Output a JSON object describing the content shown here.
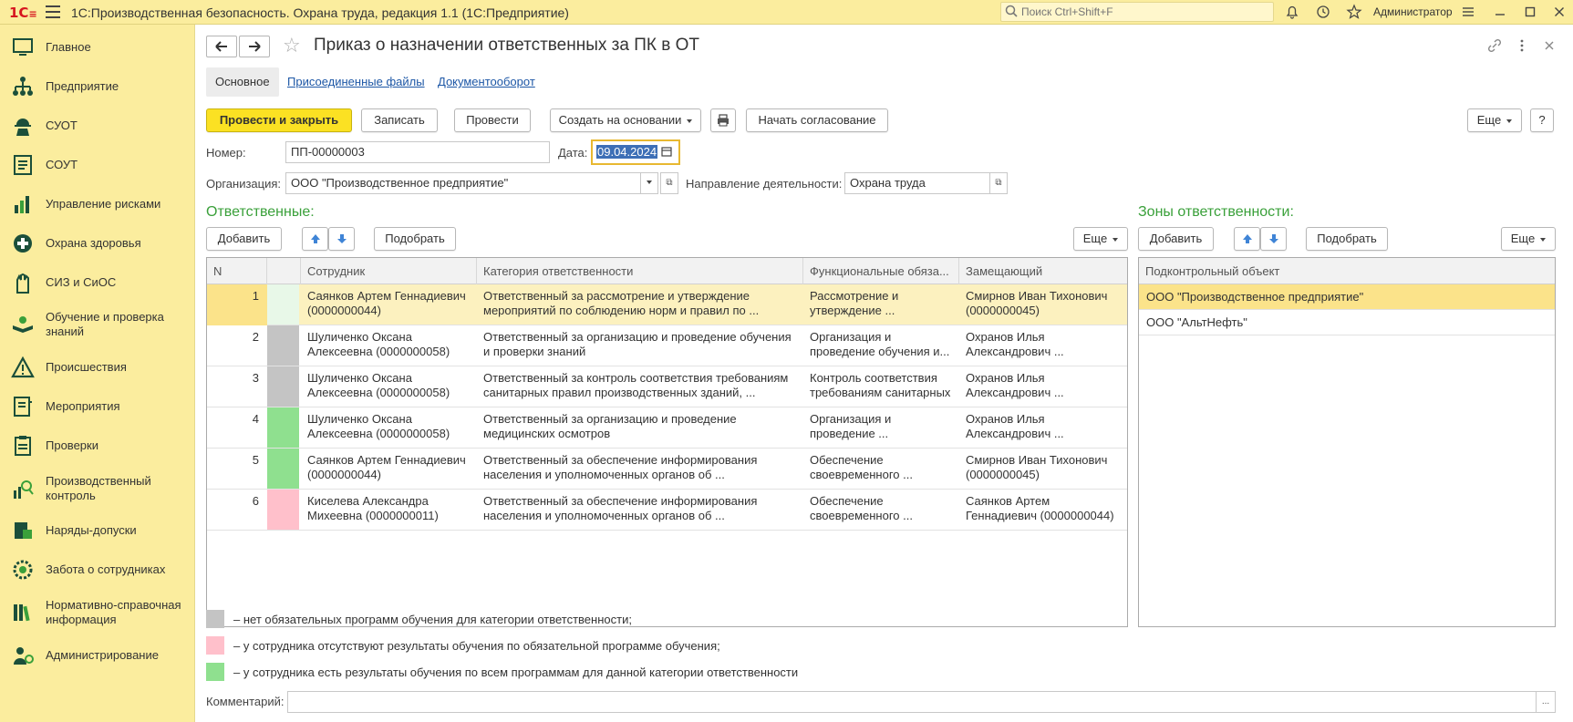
{
  "app": {
    "logo": "1С",
    "title": "1С:Производственная безопасность. Охрана труда, редакция 1.1  (1С:Предприятие)",
    "search_placeholder": "Поиск Ctrl+Shift+F",
    "user": "Администратор"
  },
  "sidebar": {
    "items": [
      {
        "label": "Главное",
        "icon": "desktop-icon"
      },
      {
        "label": "Предприятие",
        "icon": "org-structure-icon"
      },
      {
        "label": "СУОТ",
        "icon": "worker-helmet-icon"
      },
      {
        "label": "СОУТ",
        "icon": "checklist-icon"
      },
      {
        "label": "Управление рисками",
        "icon": "risk-icon"
      },
      {
        "label": "Охрана здоровья",
        "icon": "health-cross-icon"
      },
      {
        "label": "СИЗ и СиОС",
        "icon": "glove-icon"
      },
      {
        "label": "Обучение и проверка знаний",
        "icon": "training-icon"
      },
      {
        "label": "Происшествия",
        "icon": "warning-icon"
      },
      {
        "label": "Мероприятия",
        "icon": "book-icon"
      },
      {
        "label": "Проверки",
        "icon": "clipboard-icon"
      },
      {
        "label": "Производственный контроль",
        "icon": "chart-search-icon"
      },
      {
        "label": "Наряды-допуски",
        "icon": "permit-icon"
      },
      {
        "label": "Забота о сотрудниках",
        "icon": "care-gear-icon"
      },
      {
        "label": "Нормативно-справочная информация",
        "icon": "library-icon"
      },
      {
        "label": "Администрирование",
        "icon": "admin-icon"
      }
    ]
  },
  "document": {
    "title": "Приказ о назначении ответственных за ПК в ОТ",
    "tabs": [
      "Основное",
      "Присоединенные файлы",
      "Документооборот"
    ],
    "toolbar": {
      "post_close": "Провести и закрыть",
      "save": "Записать",
      "post": "Провести",
      "create_based": "Создать на основании",
      "start_approval": "Начать согласование",
      "more": "Еще",
      "help": "?"
    },
    "fields": {
      "number_label": "Номер:",
      "number_value": "ПП-00000003",
      "date_label": "Дата:",
      "date_value": "09.04.2024",
      "org_label": "Организация:",
      "org_value": "ООО \"Производственное предприятие\"",
      "direction_label": "Направление деятельности:",
      "direction_value": "Охрана труда",
      "comment_label": "Комментарий:",
      "comment_value": ""
    }
  },
  "responsible": {
    "title": "Ответственные:",
    "add": "Добавить",
    "pick": "Подобрать",
    "more": "Еще",
    "columns": [
      "N",
      "",
      "Сотрудник",
      "Категория ответственности",
      "Функциональные обяза...",
      "Замещающий"
    ],
    "rows": [
      {
        "n": "1",
        "status": "#e8f8e8",
        "employee": "Саянков Артем Геннадиевич (0000000044)",
        "category": "Ответственный за рассмотрение и утверждение мероприятий по соблюдению норм и правил по ...",
        "duties": "Рассмотрение и утверждение ...",
        "deputy": "Смирнов Иван Тихонович (0000000045)"
      },
      {
        "n": "2",
        "status": "#c4c4c4",
        "employee": "Шуличенко Оксана Алексеевна (0000000058)",
        "category": "Ответственный за организацию и проведение обучения и проверки знаний",
        "duties": "Организация и проведение обучения и...",
        "deputy": "Охранов Илья Александрович ..."
      },
      {
        "n": "3",
        "status": "#c4c4c4",
        "employee": "Шуличенко Оксана Алексеевна (0000000058)",
        "category": "Ответственный за контроль соответствия требованиям санитарных правил производственных зданий, ...",
        "duties": "Контроль соответствия требованиям санитарных",
        "deputy": "Охранов Илья Александрович ..."
      },
      {
        "n": "4",
        "status": "#8fe08f",
        "employee": "Шуличенко Оксана Алексеевна (0000000058)",
        "category": "Ответственный за организацию и проведение медицинских осмотров",
        "duties": "Организация и проведение ...",
        "deputy": "Охранов Илья Александрович ..."
      },
      {
        "n": "5",
        "status": "#8fe08f",
        "employee": "Саянков Артем Геннадиевич (0000000044)",
        "category": "Ответственный за обеспечение информирования населения и уполномоченных органов об ...",
        "duties": "Обеспечение своевременного ...",
        "deputy": "Смирнов Иван Тихонович (0000000045)"
      },
      {
        "n": "6",
        "status": "#ffc0cb",
        "employee": "Киселева Александра Михеевна (0000000011)",
        "category": "Ответственный за обеспечение информирования населения и уполномоченных органов об ...",
        "duties": "Обеспечение своевременного ...",
        "deputy": "Саянков Артем Геннадиевич (0000000044)"
      }
    ]
  },
  "zones": {
    "title": "Зоны ответственности:",
    "add": "Добавить",
    "pick": "Подобрать",
    "more": "Еще",
    "column": "Подконтрольный объект",
    "rows": [
      "ООО \"Производственное предприятие\"",
      "ООО  \"АльтНефть\""
    ]
  },
  "legend": [
    {
      "color": "#c4c4c4",
      "text": "– нет обязательных программ обучения для категории ответственности;"
    },
    {
      "color": "#ffc0cb",
      "text": "– у сотрудника отсутствуют результаты обучения по обязательной программе обучения;"
    },
    {
      "color": "#8fe08f",
      "text": "– у сотрудника есть результаты обучения по всем программам для данной категории ответственности"
    }
  ]
}
